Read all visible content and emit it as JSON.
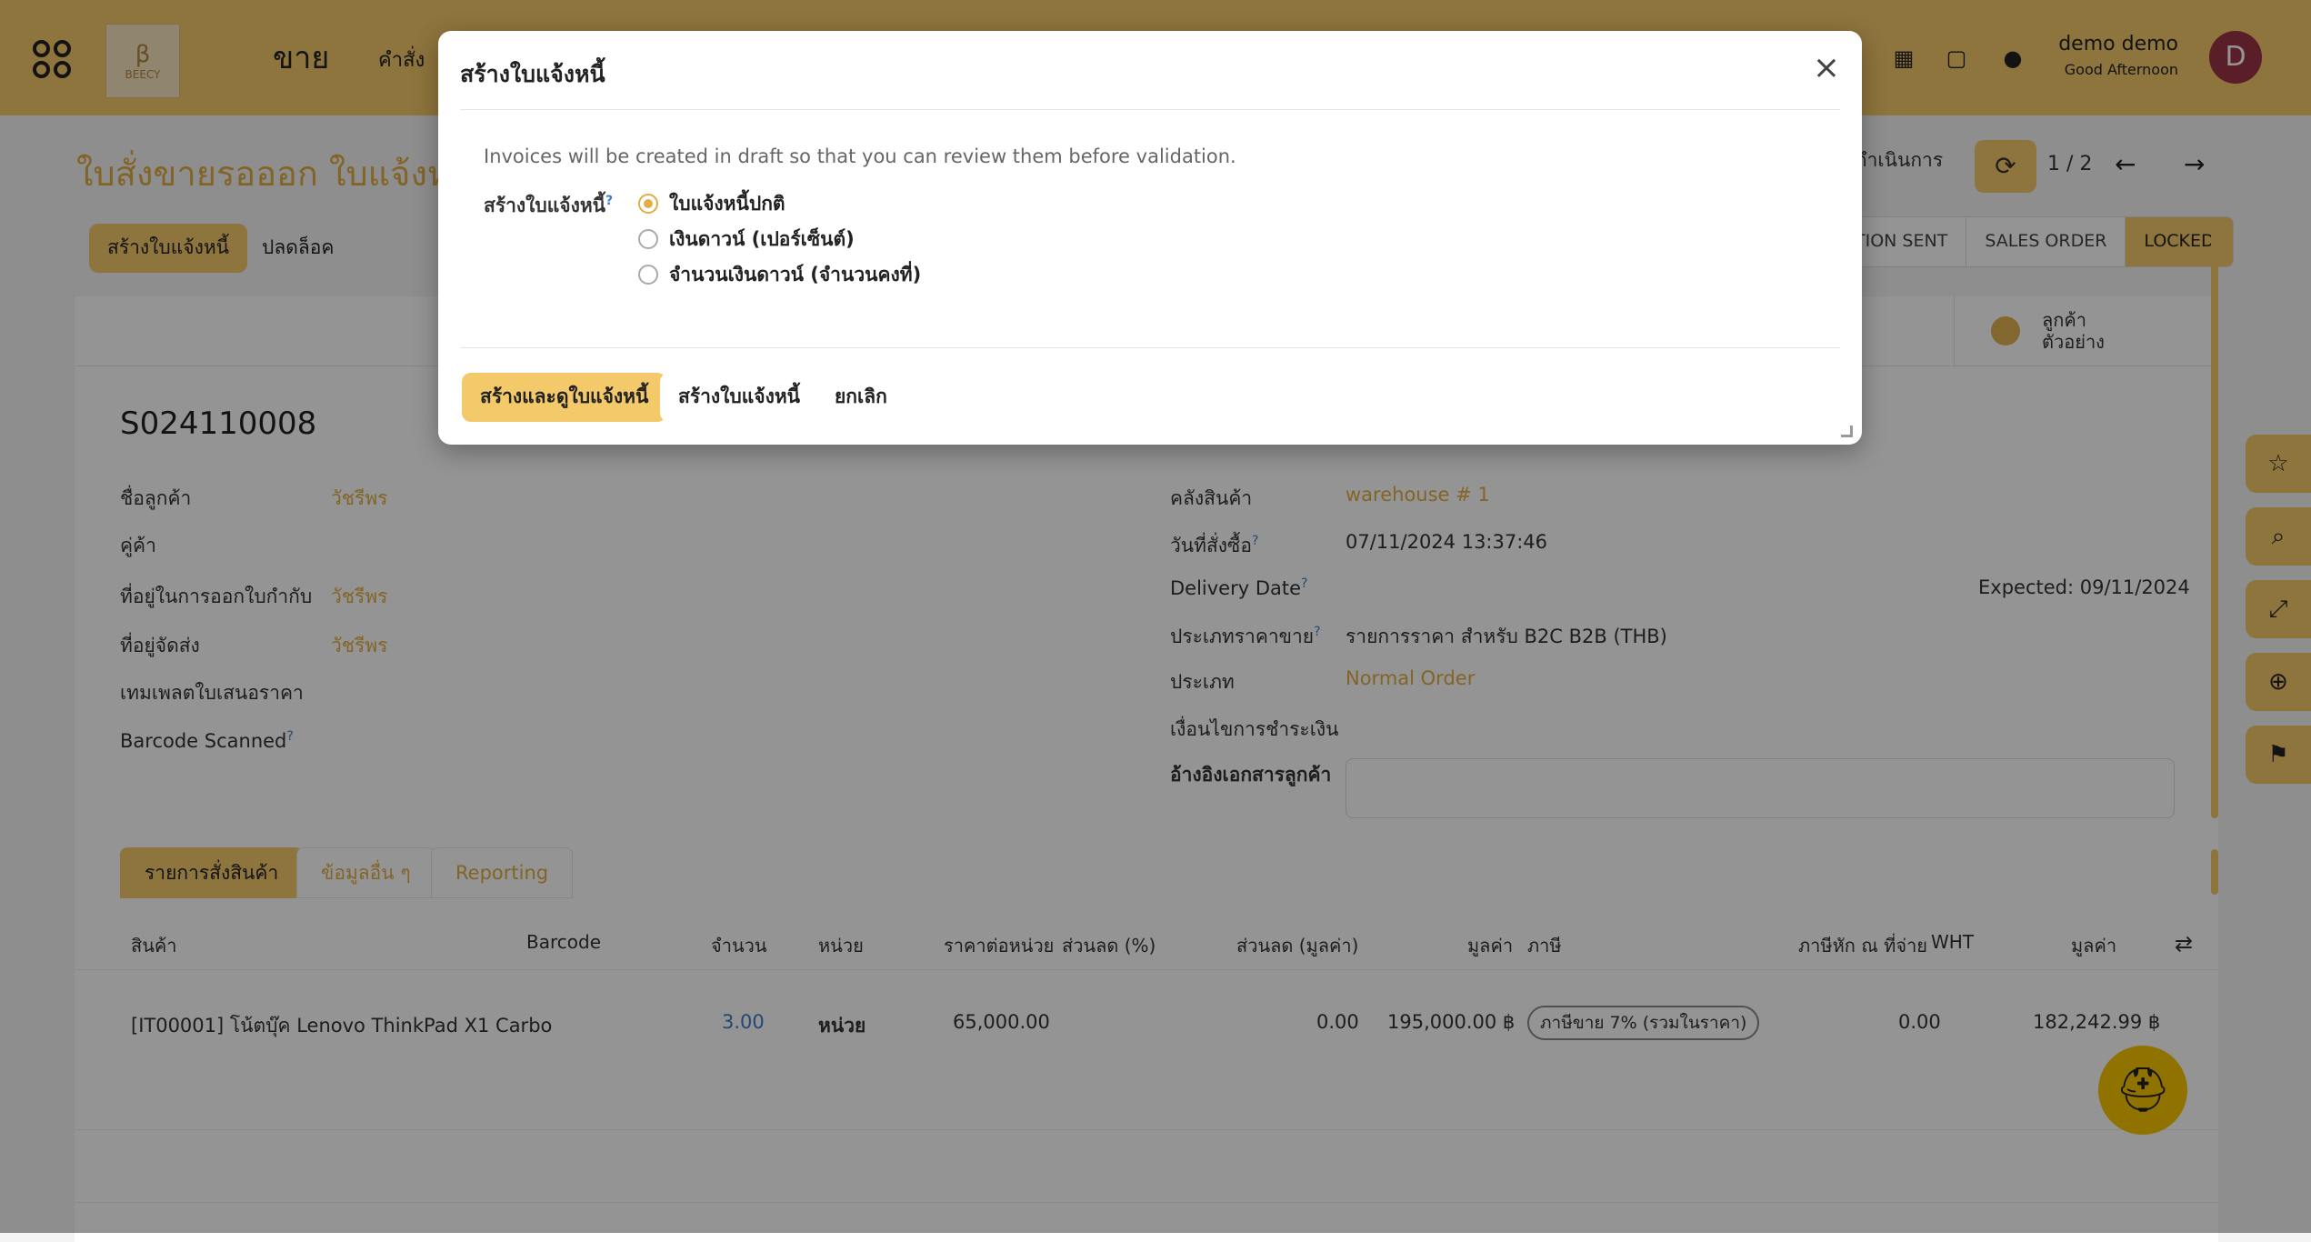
{
  "topbar": {
    "module": "ขาย",
    "menu_item": "คำสั่ง",
    "logo_text": "BEECY",
    "user_name": "demo demo",
    "greeting": "Good Afternoon",
    "avatar_letter": "D"
  },
  "breadcrumb": {
    "title": "ใบสั่งขายรอออก ใบแจ้งหนี้",
    "action_label": "ดำเนินการ",
    "pager": "1 / 2"
  },
  "buttons": {
    "create_invoice": "สร้างใบแจ้งหนี้",
    "unlock": "ปลดล็อค"
  },
  "status_bar": [
    "TION SENT",
    "SALES ORDER",
    "LOCKED"
  ],
  "smart_button": {
    "line1": "ลูกค้า",
    "line2": "ตัวอย่าง"
  },
  "order": {
    "name": "S024110008",
    "left_fields": [
      {
        "label": "ชื่อลูกค้า",
        "value": "วัชรีพร",
        "link": true
      },
      {
        "label": "คู่ค้า",
        "value": "",
        "link": false
      },
      {
        "label": "ที่อยู่ในการออกใบกำกับ",
        "value": "วัชรีพร",
        "link": true
      },
      {
        "label": "ที่อยู่จัดส่ง",
        "value": "วัชรีพร",
        "link": true
      },
      {
        "label": "เทมเพลตใบเสนอราคา",
        "value": "",
        "link": false
      },
      {
        "label": "Barcode Scanned",
        "value": "",
        "link": false
      }
    ],
    "right_fields": [
      {
        "label": "คลังสินค้า",
        "value": "warehouse # 1",
        "link": true
      },
      {
        "label": "วันที่สั่งซื้อ",
        "value": "07/11/2024 13:37:46",
        "link": false
      },
      {
        "label": "Delivery Date",
        "value": "",
        "link": false
      },
      {
        "label": "ประเภทราคาขาย",
        "value": "รายการราคา สำหรับ B2C B2B (THB)",
        "link": false
      },
      {
        "label": "ประเภท",
        "value": "Normal Order",
        "link": true
      },
      {
        "label": "เงื่อนไขการชำระเงิน",
        "value": "",
        "link": false
      },
      {
        "label": "อ้างอิงเอกสารลูกค้า",
        "value": "",
        "link": false
      }
    ],
    "expected": "Expected: 09/11/2024",
    "help_mark": "?"
  },
  "tabs": [
    "รายการสั่งสินค้า",
    "ข้อมูลอื่น ๆ",
    "Reporting"
  ],
  "table": {
    "headers": [
      "สินค้า",
      "Barcode",
      "จำนวน",
      "หน่วย",
      "ราคาต่อหน่วย",
      "ส่วนลด (%)",
      "ส่วนลด (มูลค่า)",
      "มูลค่า",
      "ภาษี",
      "ภาษีหัก ณ ที่จ่าย",
      "WHT",
      "มูลค่า"
    ],
    "row": {
      "product": "[IT00001] โน้ตบุ๊ค Lenovo ThinkPad X1 Carbo",
      "qty": "3.00",
      "unit": "หน่วย",
      "price": "65,000.00",
      "discount_amount": "0.00",
      "amount": "195,000.00 ฿",
      "tax": "ภาษีขาย 7% (รวมในราคา)",
      "wht": "0.00",
      "total": "182,242.99 ฿"
    }
  },
  "modal": {
    "title": "สร้างใบแจ้งหนี้",
    "note": "Invoices will be created in draft so that you can review them before validation.",
    "field_label": "สร้างใบแจ้งหนี้",
    "options": [
      "ใบแจ้งหนี้ปกติ",
      "เงินดาวน์ (เปอร์เซ็นต์)",
      "จำนวนเงินดาวน์ (จำนวนคงที่)"
    ],
    "selected_index": 0,
    "btn_create_view": "สร้างและดูใบแจ้งหนี้",
    "btn_create": "สร้างใบแจ้งหนี้",
    "btn_cancel": "ยกเลิก"
  },
  "colors": {
    "accent": "#f4c96a",
    "link": "#e2ad44",
    "avatar": "#9c3446"
  }
}
